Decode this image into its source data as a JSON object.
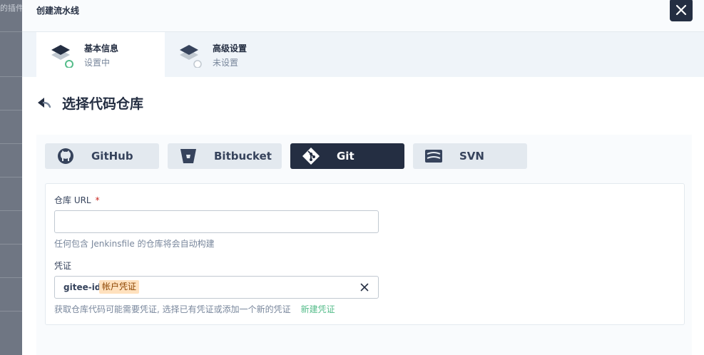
{
  "background": {
    "text": "的插件"
  },
  "modal": {
    "title": "创建流水线",
    "close_icon": "close-icon"
  },
  "steps": [
    {
      "title": "基本信息",
      "status": "设置中",
      "state": "active",
      "icon": "layers-icon"
    },
    {
      "title": "高级设置",
      "status": "未设置",
      "state": "pending",
      "icon": "layers-icon"
    }
  ],
  "page": {
    "title": "选择代码仓库",
    "back_icon": "back-arrow-icon"
  },
  "sources": [
    {
      "label": "GitHub",
      "icon": "github-icon",
      "active": false
    },
    {
      "label": "Bitbucket",
      "icon": "bitbucket-icon",
      "active": false
    },
    {
      "label": "Git",
      "icon": "git-icon",
      "active": true
    },
    {
      "label": "SVN",
      "icon": "svn-icon",
      "active": false
    }
  ],
  "form": {
    "repo_url": {
      "label": "仓库 URL",
      "required_mark": "*",
      "value": "",
      "placeholder": "",
      "hint": "任何包含 Jenkinsfile 的仓库将会自动构建"
    },
    "credential": {
      "label": "凭证",
      "value": "gitee-id",
      "tag": "帐户凭证",
      "hint": "获取仓库代码可能需要凭证, 选择已有凭证或添加一个新的凭证",
      "new_link": "新建凭证"
    }
  },
  "colors": {
    "accent_dark": "#242e42",
    "success": "#55bc8a",
    "required": "#ca2621",
    "tag_bg": "#ffe1be"
  }
}
